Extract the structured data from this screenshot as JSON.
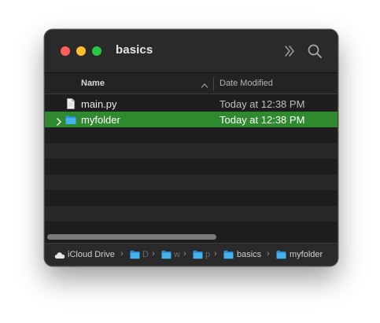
{
  "window": {
    "title": "basics"
  },
  "toolbar": {
    "more_icon": "double-chevron-right-icon",
    "search_icon": "magnifying-glass-icon"
  },
  "columns": {
    "name": "Name",
    "date_modified": "Date Modified",
    "sort": "ascending"
  },
  "files": [
    {
      "name": "main.py",
      "date": "Today at 12:38 PM",
      "icon": "document-icon",
      "selected": false
    },
    {
      "name": "myfolder",
      "date": "Today at 12:38 PM",
      "icon": "folder-icon",
      "selected": true,
      "expandable": true
    }
  ],
  "pathbar": {
    "items": [
      {
        "label": "iCloud Drive",
        "icon": "cloud-icon"
      },
      {
        "label": "D",
        "icon": "folder-icon"
      },
      {
        "label": "w",
        "icon": "folder-icon"
      },
      {
        "label": "p",
        "icon": "folder-icon"
      },
      {
        "label": "basics",
        "icon": "folder-icon"
      },
      {
        "label": "myfolder",
        "icon": "folder-icon"
      }
    ],
    "separator": "›"
  },
  "colors": {
    "selection": "#2f8a2f",
    "close": "#ff5f57",
    "minimize": "#febc2e",
    "zoom": "#28c840",
    "folder": "#3aa3e3"
  }
}
